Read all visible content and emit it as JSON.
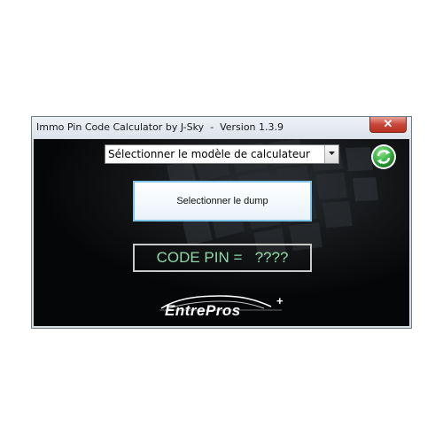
{
  "window": {
    "title": "Immo Pin Code Calculator by J-Sky  -  Version 1.3.9",
    "close_label": "✕"
  },
  "calculator_select": {
    "selected_value": "Sélectionner le modèle de calculateur"
  },
  "icons": {
    "refresh": "refresh-icon",
    "dropdown": "chevron-down-icon"
  },
  "dump_button": {
    "label": "Selectionner le dump"
  },
  "pin_display": {
    "text": "CODE PIN =   ????"
  },
  "logo": {
    "text": "EntrePros",
    "plus": "+"
  },
  "colors": {
    "background": "#050607",
    "pin_text": "#8fd8a8",
    "dump_border": "#7ec5ea",
    "refresh_green": "#3fb94a"
  }
}
